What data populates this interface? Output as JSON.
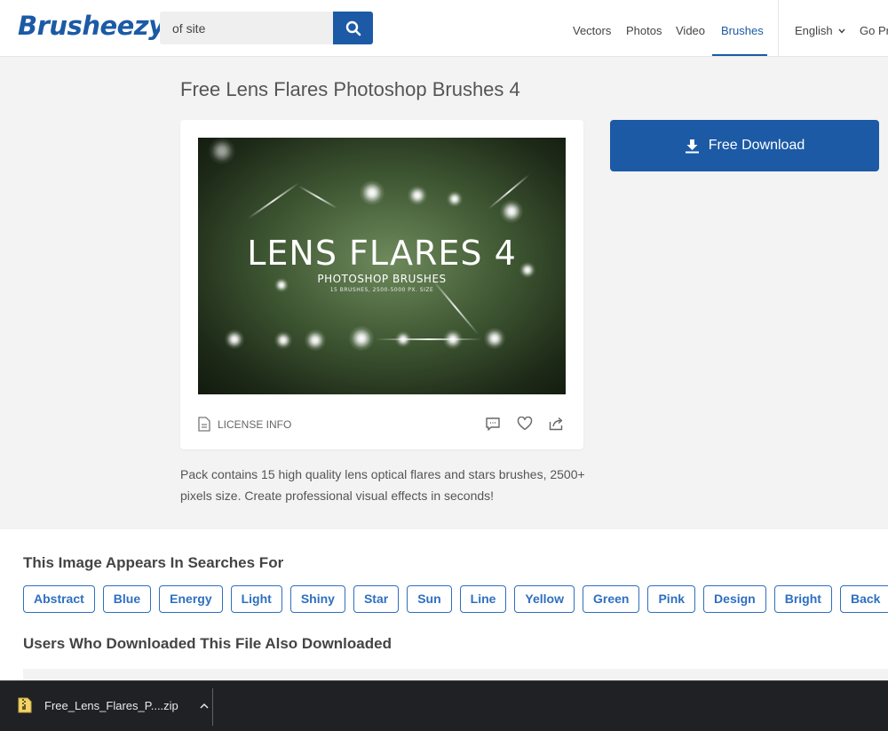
{
  "header": {
    "logo": "Brusheezy",
    "search": {
      "value": "of site",
      "placeholder": ""
    },
    "nav": [
      {
        "label": "Vectors",
        "active": false
      },
      {
        "label": "Photos",
        "active": false
      },
      {
        "label": "Video",
        "active": false
      },
      {
        "label": "Brushes",
        "active": true
      }
    ],
    "language": "English",
    "go_pro": "Go Pro"
  },
  "main": {
    "title": "Free Lens Flares Photoshop Brushes 4",
    "preview": {
      "title": "LENS FLARES 4",
      "subtitle": "PHOTOSHOP BRUSHES",
      "meta": "15 BRUSHES, 2500-5000 PX. SIZE"
    },
    "license_label": "LICENSE INFO",
    "download_label": "Free Download",
    "description": "Pack contains 15 high quality lens optical flares and stars brushes, 2500+ pixels size. Create professional visual effects in seconds!"
  },
  "searches": {
    "title": "This Image Appears In Searches For",
    "tags": [
      "Abstract",
      "Blue",
      "Energy",
      "Light",
      "Shiny",
      "Star",
      "Sun",
      "Line",
      "Yellow",
      "Green",
      "Pink",
      "Design",
      "Bright",
      "Back"
    ]
  },
  "also_downloaded": {
    "title": "Users Who Downloaded This File Also Downloaded"
  },
  "download_bar": {
    "filename": "Free_Lens_Flares_P....zip"
  },
  "colors": {
    "brand": "#1c5aa6",
    "tag": "#2e6fc1",
    "download_bar": "#202124"
  }
}
